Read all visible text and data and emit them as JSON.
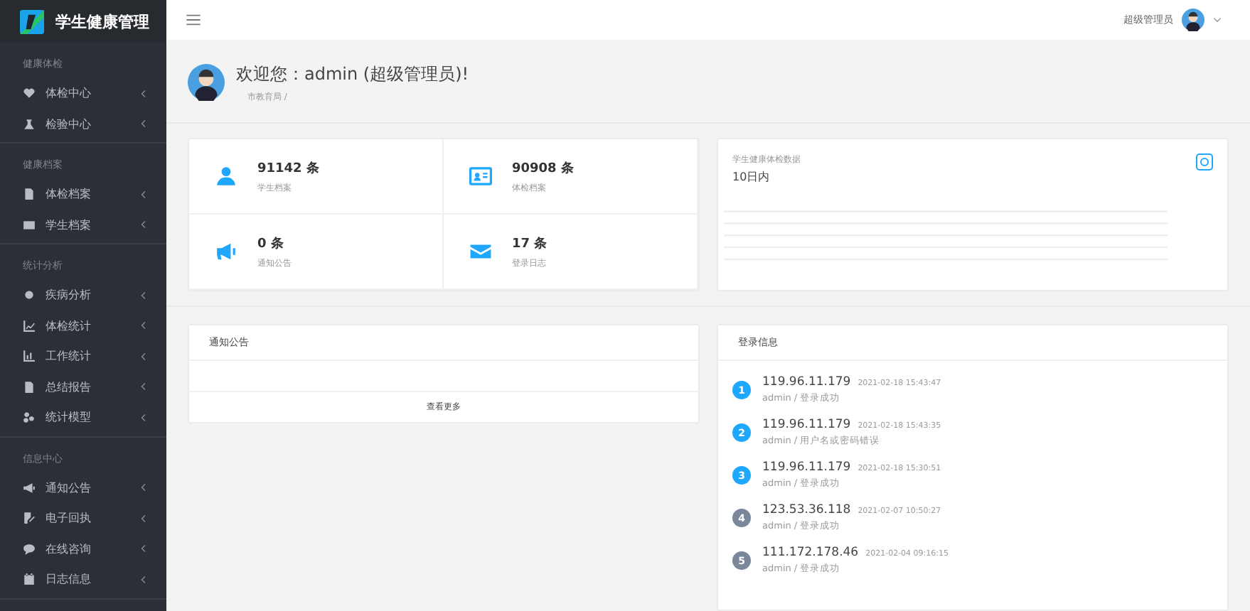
{
  "app": {
    "title": "学生健康管理"
  },
  "sidebar": {
    "groups": [
      {
        "title": "健康体检",
        "items": [
          {
            "label": "体检中心",
            "kind": "heart"
          },
          {
            "label": "检验中心",
            "kind": "flask"
          }
        ]
      },
      {
        "title": "健康档案",
        "items": [
          {
            "label": "体检档案",
            "kind": "doc"
          },
          {
            "label": "学生档案",
            "kind": "card"
          }
        ]
      },
      {
        "title": "统计分析",
        "items": [
          {
            "label": "疾病分析",
            "kind": "virus"
          },
          {
            "label": "体检统计",
            "kind": "line"
          },
          {
            "label": "工作统计",
            "kind": "bars"
          },
          {
            "label": "总结报告",
            "kind": "doc"
          },
          {
            "label": "统计模型",
            "kind": "model"
          }
        ]
      },
      {
        "title": "信息中心",
        "items": [
          {
            "label": "通知公告",
            "kind": "megaphone"
          },
          {
            "label": "电子回执",
            "kind": "edit"
          },
          {
            "label": "在线咨询",
            "kind": "chat"
          },
          {
            "label": "日志信息",
            "kind": "calendar"
          }
        ]
      }
    ]
  },
  "header": {
    "user": "超级管理员"
  },
  "welcome": {
    "title": "欢迎您：admin (超级管理员)!",
    "subtitle": "市教育局 /"
  },
  "stats": [
    {
      "value": "91142 条",
      "label": "学生档案",
      "kind": "person"
    },
    {
      "value": "90908 条",
      "label": "体检档案",
      "kind": "card"
    },
    {
      "value": "0 条",
      "label": "通知公告",
      "kind": "megaphone"
    },
    {
      "value": "17 条",
      "label": "登录日志",
      "kind": "mail"
    }
  ],
  "chart_card": {
    "title": "学生健康体检数据",
    "period": "10日内"
  },
  "notices": {
    "title": "通知公告",
    "more": "查看更多"
  },
  "logins": {
    "title": "登录信息",
    "items": [
      {
        "index": "1",
        "ip": "119.96.11.179",
        "time": "2021-02-18 15:43:47",
        "detail": "admin / 登录成功",
        "color": "#1ea7fd"
      },
      {
        "index": "2",
        "ip": "119.96.11.179",
        "time": "2021-02-18 15:43:35",
        "detail": "admin / 用户名或密码错误",
        "color": "#1ea7fd"
      },
      {
        "index": "3",
        "ip": "119.96.11.179",
        "time": "2021-02-18 15:30:51",
        "detail": "admin / 登录成功",
        "color": "#1ea7fd"
      },
      {
        "index": "4",
        "ip": "123.53.36.118",
        "time": "2021-02-07 10:50:27",
        "detail": "admin / 登录成功",
        "color": "#7a8699"
      },
      {
        "index": "5",
        "ip": "111.172.178.46",
        "time": "2021-02-04 09:16:15",
        "detail": "admin / 登录成功",
        "color": "#7a8699"
      }
    ]
  }
}
